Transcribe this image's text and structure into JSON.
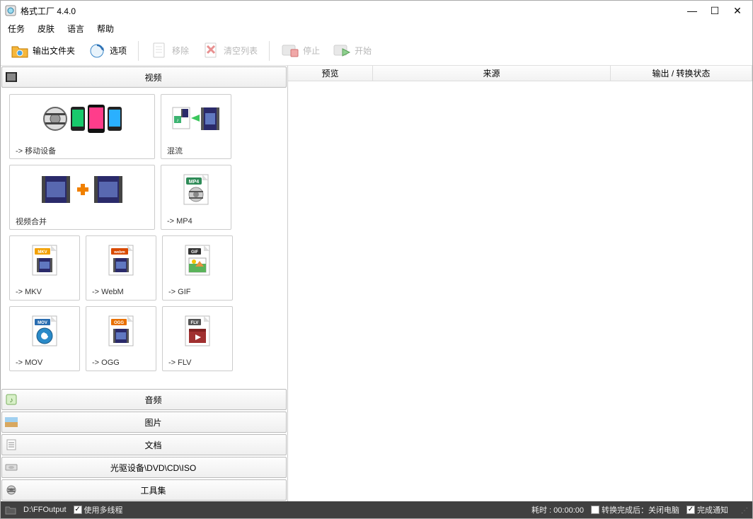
{
  "titlebar": {
    "title": "格式工厂 4.4.0"
  },
  "menubar": {
    "task": "任务",
    "skin": "皮肤",
    "language": "语言",
    "help": "帮助"
  },
  "toolbar": {
    "output_folder": "输出文件夹",
    "options": "选项",
    "remove": "移除",
    "clear_list": "清空列表",
    "stop": "停止",
    "start": "开始"
  },
  "accordion": {
    "video": "视频",
    "audio": "音频",
    "image": "图片",
    "document": "文档",
    "drive": "光驱设备\\DVD\\CD\\ISO",
    "toolkit": "工具集"
  },
  "tiles": {
    "mobile": "-> 移动设备",
    "mux": "混流",
    "merge": "视频合并",
    "mp4": "-> MP4",
    "mkv": "-> MKV",
    "webm": "-> WebM",
    "gif": "-> GIF",
    "mov": "-> MOV",
    "ogg": "-> OGG",
    "flv": "-> FLV"
  },
  "list_headers": {
    "preview": "预览",
    "source": "来源",
    "status": "输出 / 转换状态"
  },
  "statusbar": {
    "output_path": "D:\\FFOutput",
    "multithread": "使用多线程",
    "elapsed": "耗时 : 00:00:00",
    "shutdown": "转换完成后：关闭电脑",
    "notify": "完成通知"
  }
}
